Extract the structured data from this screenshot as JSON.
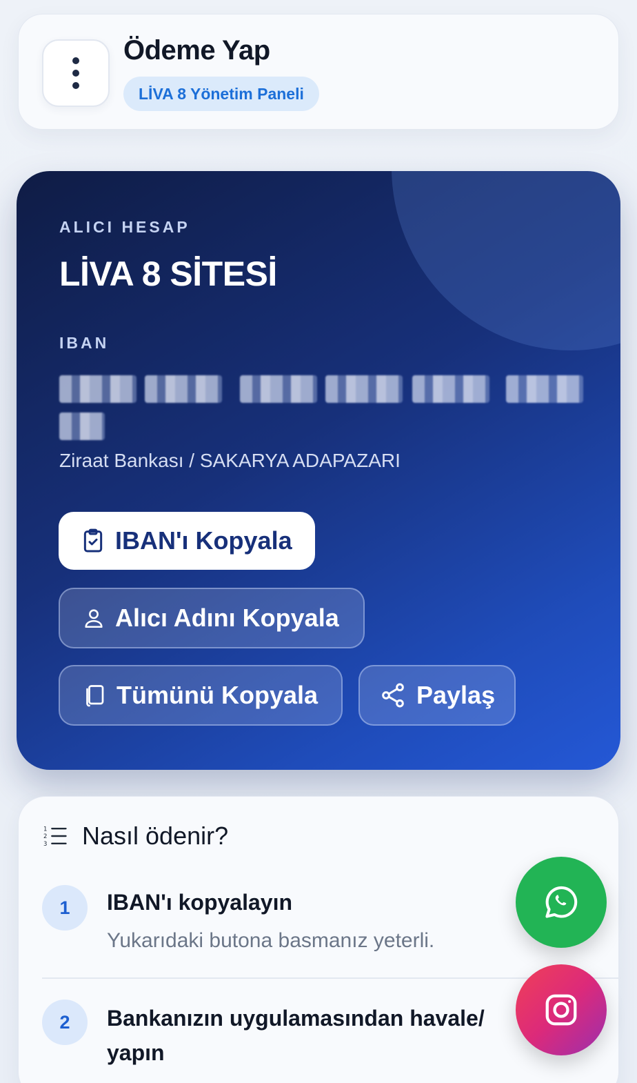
{
  "header": {
    "title": "Ödeme Yap",
    "badge": "LİVA 8 Yönetim Paneli",
    "menu_icon": "more-vertical-icon"
  },
  "account": {
    "recipient_label": "ALICI HESAP",
    "recipient_name": "LİVA 8 SİTESİ",
    "iban_label": "IBAN",
    "iban_value_obscured": true,
    "bank_info": "Ziraat Bankası / SAKARYA ADAPAZARI"
  },
  "actions": {
    "copy_iban": {
      "label": "IBAN'ı Kopyala",
      "icon": "clipboard-check-icon"
    },
    "copy_recipient": {
      "label": "Alıcı Adını Kopyala",
      "icon": "user-icon"
    },
    "copy_all": {
      "label": "Tümünü Kopyala",
      "icon": "copy-icon"
    },
    "share": {
      "label": "Paylaş",
      "icon": "share-icon"
    }
  },
  "howto": {
    "title": "Nasıl ödenir?",
    "icon": "ordered-list-icon",
    "steps": [
      {
        "number": "1",
        "title": "IBAN'ı kopyalayın",
        "desc": "Yukarıdaki butona basmanız yeterli."
      },
      {
        "number": "2",
        "title_line1": "Bankanızın uygulamasından havale/",
        "title_line2": "yapın"
      }
    ]
  },
  "floating": {
    "whatsapp": {
      "icon": "whatsapp-icon",
      "color": "#22b455"
    },
    "instagram": {
      "icon": "instagram-icon",
      "color": "#dc2a7a"
    }
  },
  "colors": {
    "card_gradient_start": "#0f1c45",
    "card_gradient_end": "#2458d6",
    "badge_text": "#1c6fd8",
    "step_number": "#1d5fd0"
  }
}
